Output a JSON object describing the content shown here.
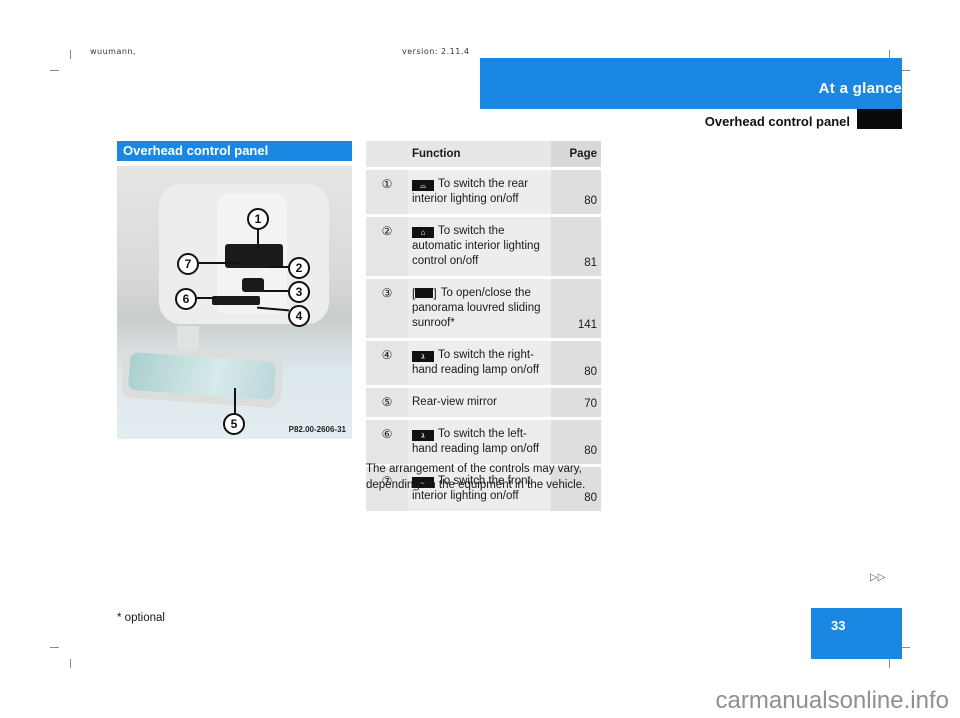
{
  "header": {
    "left_meta": "wuumann,",
    "right_meta": "version: 2.11.4",
    "chapter": "At a glance",
    "section": "Overhead control panel"
  },
  "left_panel": {
    "heading": "Overhead control panel",
    "figure_code": "P82.00-2606-31",
    "callouts": [
      "1",
      "2",
      "3",
      "4",
      "5",
      "6",
      "7"
    ]
  },
  "table": {
    "headers": {
      "number": "",
      "function": "Function",
      "page": "Page"
    },
    "rows": [
      {
        "number": "①",
        "icon": "rear-interior-light-icon",
        "text": "To switch the rear interior lighting on/off",
        "page": "80"
      },
      {
        "number": "②",
        "icon": "auto-interior-light-icon",
        "text": "To switch the automatic interior lighting control on/off",
        "text_display": "To switch the auto-matic interior lighting con-trol on/off",
        "page": "81"
      },
      {
        "number": "③",
        "icon": "sunroof-switch-icon",
        "text": "To open/close the panorama louvred sliding sunroof*",
        "page": "141"
      },
      {
        "number": "④",
        "icon": "reading-lamp-icon",
        "text": "To switch the right-hand reading lamp on/off",
        "page": "80"
      },
      {
        "number": "⑤",
        "icon": "",
        "text": "Rear-view mirror",
        "page": "70"
      },
      {
        "number": "⑥",
        "icon": "reading-lamp-icon",
        "text": "To switch the left-hand reading lamp on/off",
        "page": "80"
      },
      {
        "number": "⑦",
        "icon": "front-interior-light-icon",
        "text": "To switch the front interior lighting on/off",
        "page": "80"
      }
    ]
  },
  "note": "The arrangement of the controls may vary, depending on the equipment in the vehicle.",
  "footnote": "* optional",
  "continue_mark": "▷▷",
  "page_number": "33",
  "watermark": "carmanualsonline.info",
  "colors": {
    "accent": "#1a88e2",
    "tab": "#0a0a0a"
  }
}
